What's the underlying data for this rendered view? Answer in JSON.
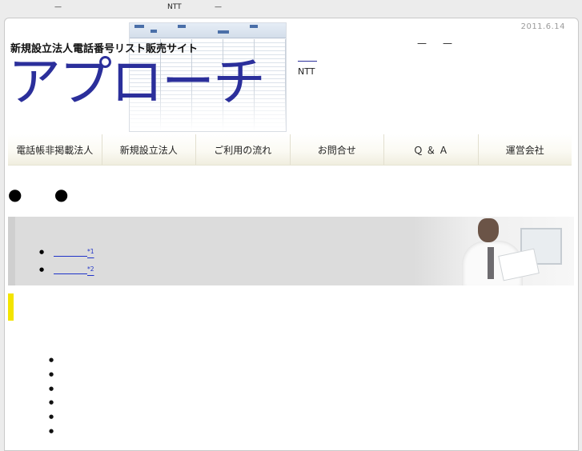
{
  "top_bar": {
    "dash_left": "—",
    "ntt": "NTT",
    "dash_right": "—"
  },
  "header": {
    "date": "2011.6.14",
    "tagline": "新規設立法人電話番号リスト販売サイト",
    "logo_text": "アプローチ",
    "dash_a": "—",
    "dash_b": "—",
    "ntt": "NTT"
  },
  "nav": {
    "items": [
      {
        "label": "電話帳非掲載法人"
      },
      {
        "label": "新規設立法人"
      },
      {
        "label": "ご利用の流れ"
      },
      {
        "label": "お問合せ"
      },
      {
        "label": "Ｑ ＆ Ａ"
      },
      {
        "label": "運営会社"
      }
    ]
  },
  "section": {
    "bullet_a": "●",
    "bullet_b": "●"
  },
  "banner": {
    "links": [
      {
        "sup": "*1"
      },
      {
        "sup": "*2"
      }
    ]
  },
  "list": {
    "items": [
      "",
      "",
      "",
      "",
      "",
      ""
    ]
  },
  "colors": {
    "logo": "#2b2f9b",
    "accent_bar": "#f3e400",
    "link": "#2034c8"
  }
}
